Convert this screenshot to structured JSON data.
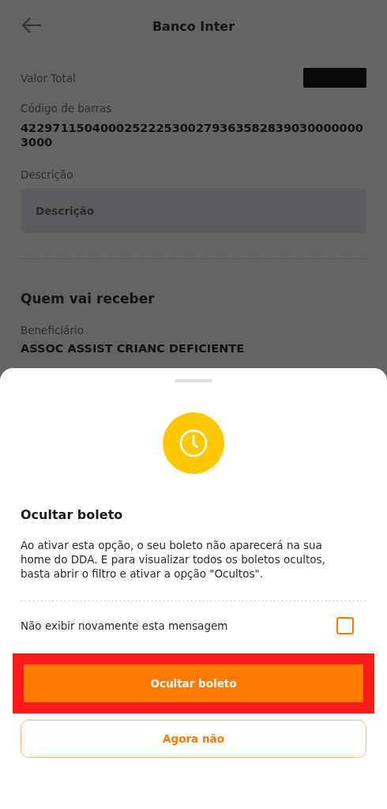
{
  "header": {
    "title": "Banco Inter"
  },
  "fields": [
    {
      "kind": "amount",
      "label": "Valor Total",
      "redacted": true
    },
    {
      "kind": "text",
      "label": "Código de barras",
      "value": "42297115040002522253002793635828390300000003000"
    },
    {
      "kind": "input",
      "label": "Descrição",
      "placeholder": "Descrição"
    }
  ],
  "recipient": {
    "title": "Quem vai receber",
    "label": "Beneficiário",
    "value": "ASSOC ASSIST CRIANC DEFICIENTE"
  },
  "sheet": {
    "title": "Ocultar boleto",
    "body": "Ao ativar esta opção, o seu boleto não aparecerá na sua home do DDA. E para visualizar todos os boletos ocultos, basta abrir o filtro e ativar a opção \"Ocultos\".",
    "checkbox": {
      "label": "Não exibir novamente esta mensagem",
      "checked": false
    },
    "buttons": [
      {
        "kind": "primary",
        "label": "Ocultar boleto",
        "highlighted": true
      },
      {
        "kind": "secondary",
        "label": "Agora não",
        "highlighted": false
      }
    ]
  }
}
